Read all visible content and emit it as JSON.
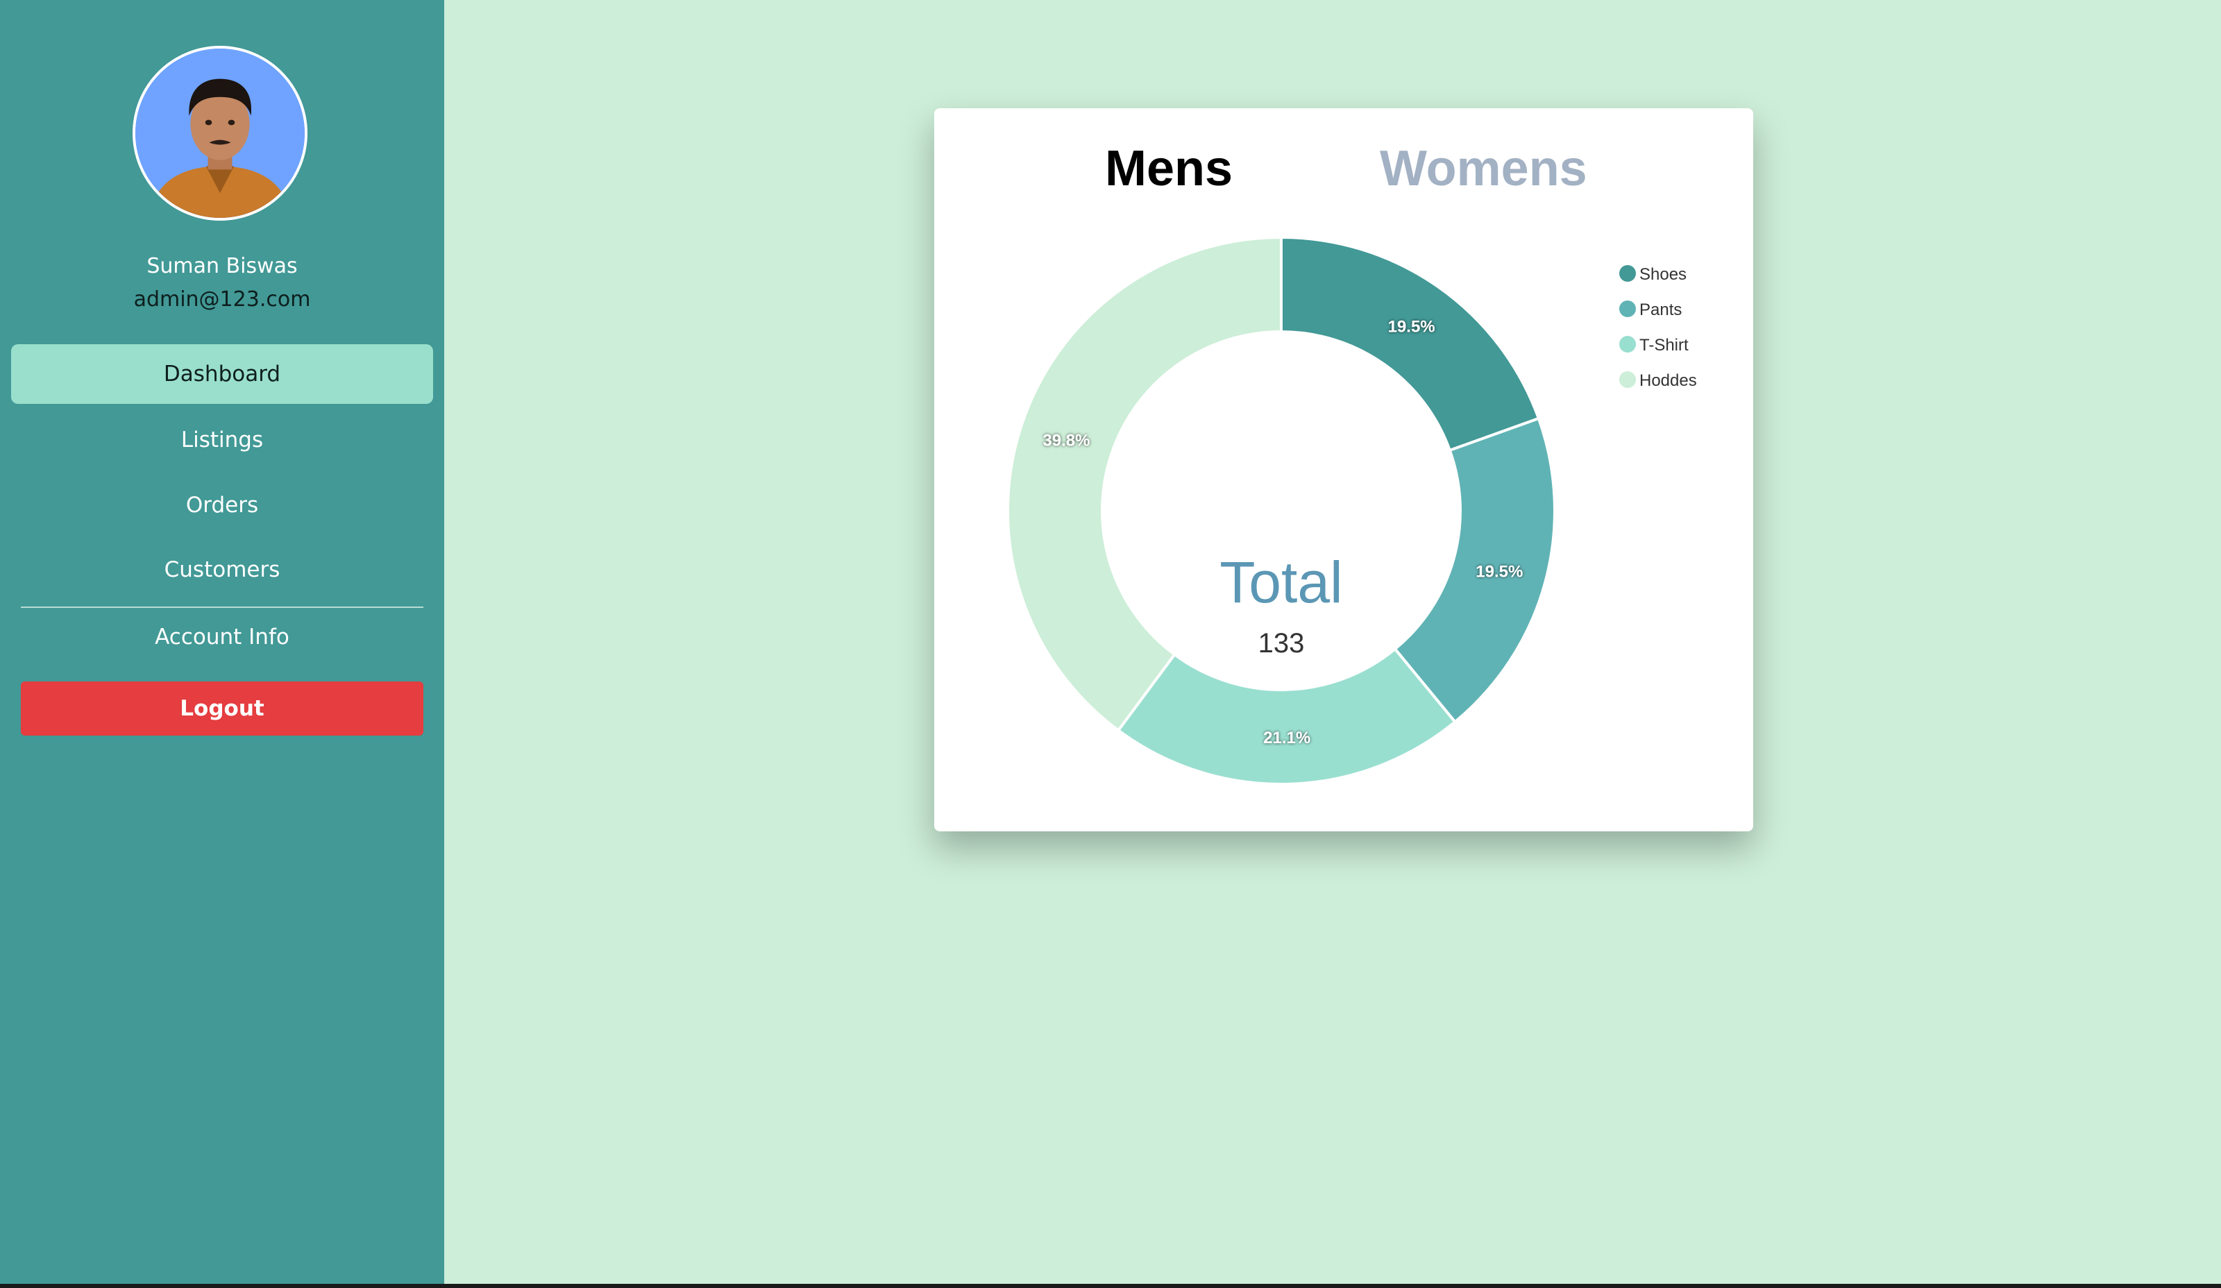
{
  "profile": {
    "name": "Suman Biswas",
    "email": "admin@123.com"
  },
  "nav": {
    "items": [
      {
        "label": "Dashboard",
        "active": true
      },
      {
        "label": "Listings",
        "active": false
      },
      {
        "label": "Orders",
        "active": false
      },
      {
        "label": "Customers",
        "active": false
      },
      {
        "label": "Account Info",
        "active": false
      }
    ],
    "logout_label": "Logout"
  },
  "tabs": {
    "mens": "Mens",
    "womens": "Womens",
    "selected": "Mens"
  },
  "colors": {
    "sidebar": "#429996",
    "active_nav": "#99dfcc",
    "logout": "#e53d40",
    "background": "#cdeed8"
  },
  "chart_data": {
    "type": "pie",
    "variant": "doughnut",
    "center_title": "Total",
    "center_value": "133",
    "legend_position": "top-right",
    "slices": [
      {
        "label": "Shoes",
        "value": 19.5,
        "display": "19.5%",
        "color": "#429996"
      },
      {
        "label": "Pants",
        "value": 19.5,
        "display": "19.5%",
        "color": "#60b3b5"
      },
      {
        "label": "T-Shirt",
        "value": 21.1,
        "display": "21.1%",
        "color": "#99dfd0"
      },
      {
        "label": "Hoddes",
        "value": 39.8,
        "display": "39.8%",
        "color": "#cdeed8"
      }
    ]
  }
}
